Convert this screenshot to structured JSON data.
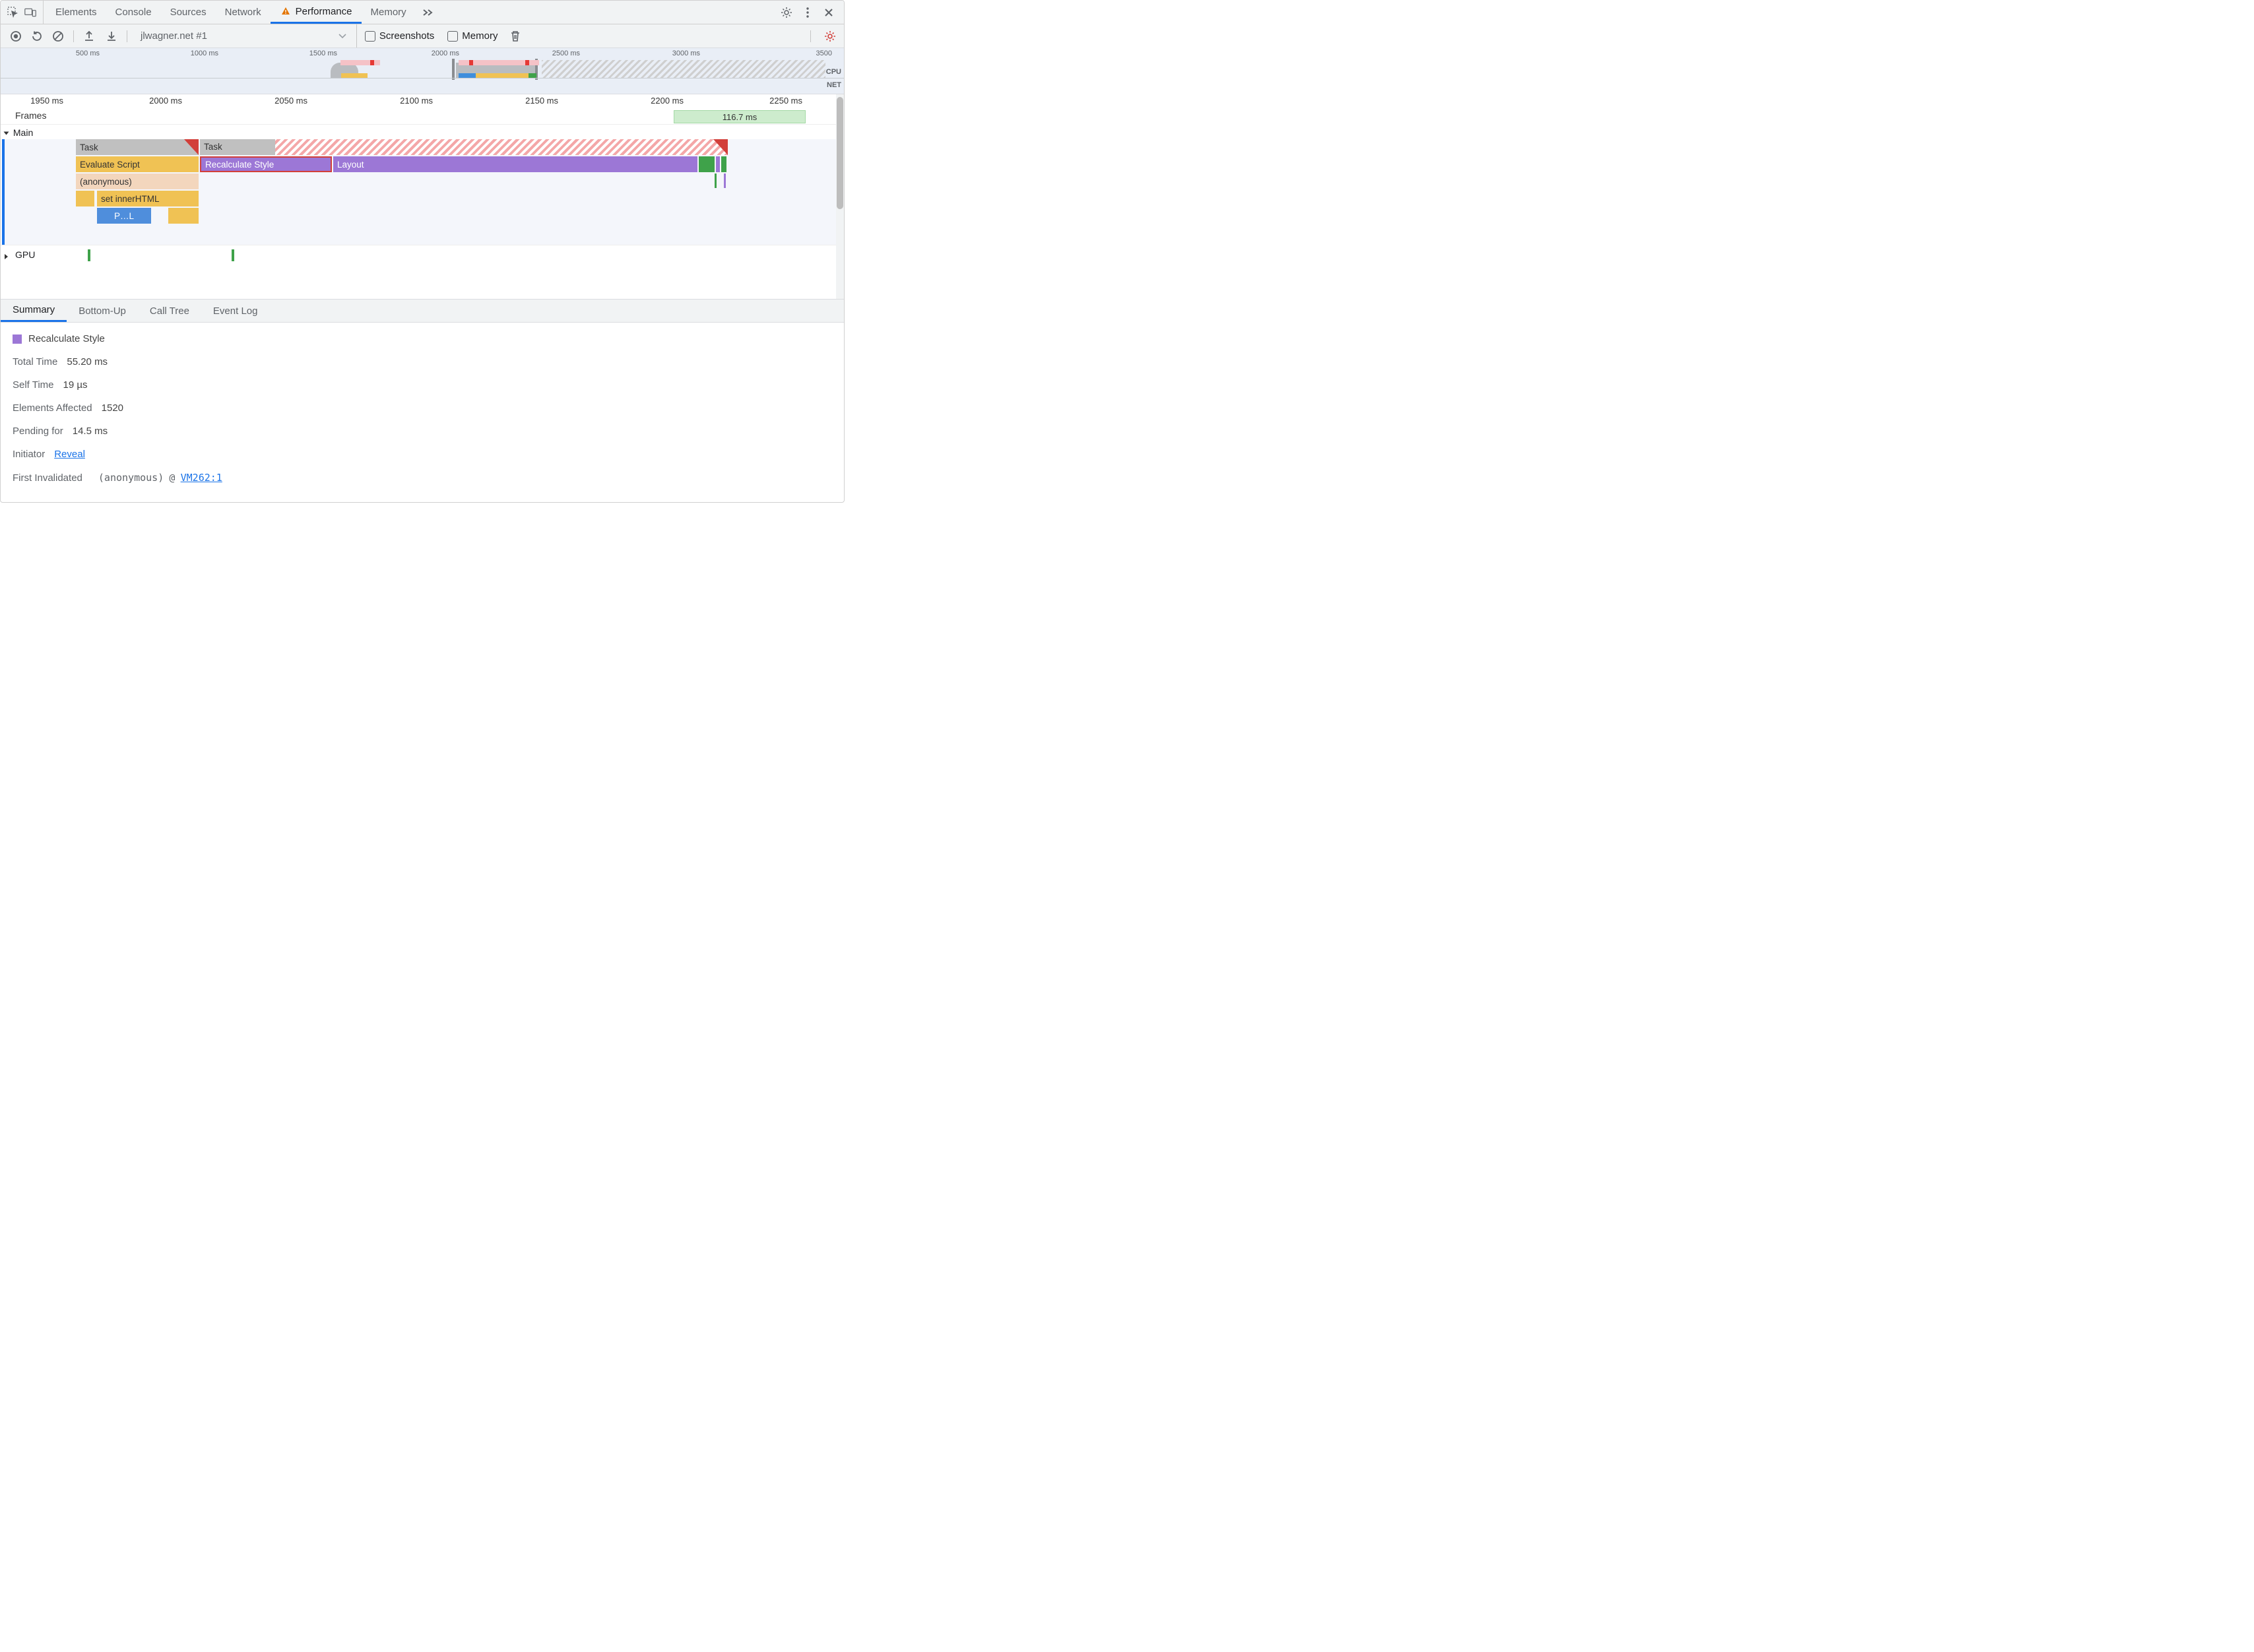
{
  "tabs": {
    "elements": "Elements",
    "console": "Console",
    "sources": "Sources",
    "network": "Network",
    "performance": "Performance",
    "memory": "Memory"
  },
  "toolbar": {
    "site_label": "jlwagner.net #1",
    "screenshots_label": "Screenshots",
    "memory_label": "Memory"
  },
  "overview": {
    "ticks": [
      "500 ms",
      "1000 ms",
      "1500 ms",
      "2000 ms",
      "2500 ms",
      "3000 ms",
      "3500"
    ],
    "cpu_label": "CPU",
    "net_label": "NET"
  },
  "ruler": [
    "1950 ms",
    "2000 ms",
    "2050 ms",
    "2100 ms",
    "2150 ms",
    "2200 ms",
    "2250 ms"
  ],
  "frames": {
    "label": "Frames",
    "block": "116.7 ms"
  },
  "main": {
    "label": "Main",
    "task1": "Task",
    "task2": "Task",
    "eval_script": "Evaluate Script",
    "anon": "(anonymous)",
    "set_inner": "set innerHTML",
    "pl": "P…L",
    "recalc": "Recalculate Style",
    "layout": "Layout"
  },
  "gpu": {
    "label": "GPU"
  },
  "detail_tabs": {
    "summary": "Summary",
    "bottom_up": "Bottom-Up",
    "call_tree": "Call Tree",
    "event_log": "Event Log"
  },
  "summary": {
    "title": "Recalculate Style",
    "rows": {
      "total_time_k": "Total Time",
      "total_time_v": "55.20 ms",
      "self_time_k": "Self Time",
      "self_time_v": "19 µs",
      "elements_k": "Elements Affected",
      "elements_v": "1520",
      "pending_k": "Pending for",
      "pending_v": "14.5 ms",
      "initiator_k": "Initiator",
      "initiator_v": "Reveal",
      "first_inval_k": "First Invalidated",
      "first_inval_fn": "(anonymous)",
      "first_inval_at": "@",
      "first_inval_src": "VM262:1"
    }
  }
}
